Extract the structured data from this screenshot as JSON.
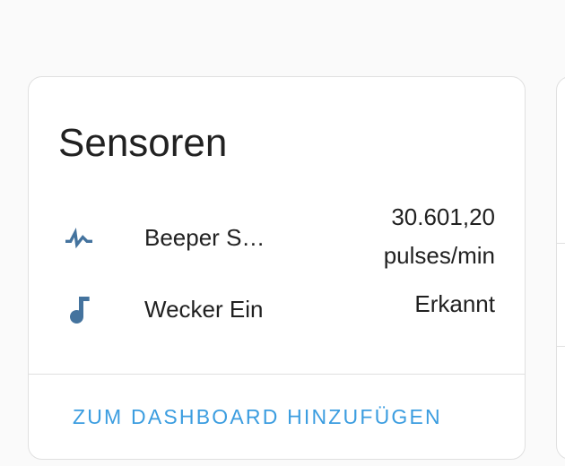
{
  "card": {
    "title": "Sensoren",
    "entities": [
      {
        "icon": "pulse-icon",
        "name": "Beeper S…",
        "state_value": "30.601,20",
        "state_unit": "pulses/min"
      },
      {
        "icon": "music-note-icon",
        "name": "Wecker Ein",
        "state_value": "Erkannt"
      }
    ],
    "action_label": "ZUM DASHBOARD HINZUFÜGEN"
  },
  "colors": {
    "icon": "#44739e",
    "action": "#3b9de0",
    "text": "#212121",
    "border": "#e0e0e0",
    "background": "#fafafa"
  }
}
